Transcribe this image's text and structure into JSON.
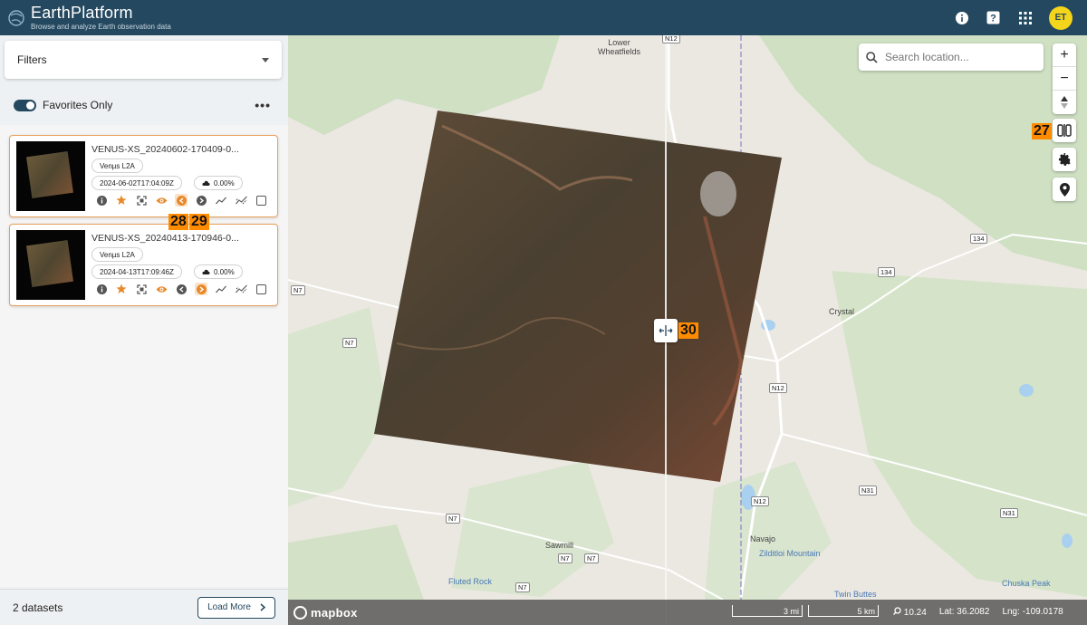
{
  "app": {
    "title": "EarthPlatform",
    "subtitle": "Browse and analyze Earth observation data",
    "user_initials": "ET"
  },
  "colors": {
    "header": "#24485f",
    "accent": "#e8a15d",
    "avatar": "#f4d51b"
  },
  "sidebar": {
    "filters_label": "Filters",
    "favorites_label": "Favorites Only",
    "favorites_enabled": true,
    "datasets": [
      {
        "title": "VENUS-XS_20240602-170409-0...",
        "product": "Venµs L2A",
        "datetime": "2024-06-02T17:04:09Z",
        "cloud": "0.00%"
      },
      {
        "title": "VENUS-XS_20240413-170946-0...",
        "product": "Venµs L2A",
        "datetime": "2024-04-13T17:09:46Z",
        "cloud": "0.00%"
      }
    ],
    "count_label": "2 datasets",
    "load_more_label": "Load More"
  },
  "annotations": {
    "t27": "27",
    "t28": "28",
    "t29": "29",
    "t30": "30"
  },
  "map": {
    "search_placeholder": "Search location...",
    "zoom_in": "+",
    "zoom_out": "−",
    "places": {
      "lower_wheatfields": "Lower\nWheatfields",
      "crystal": "Crystal",
      "sawmill": "Sawmill",
      "navajo": "Navajo",
      "zilditloi": "Zilditloi Mountain",
      "fluted_rock": "Fluted Rock",
      "twin_buttes": "Twin Buttes",
      "chuska_peak": "Chuska Peak"
    },
    "roads": {
      "n12": "N12",
      "n7": "N7",
      "n31": "N31",
      "n134": "134"
    },
    "attribution": "mapbox",
    "scale_mi": "3 mi",
    "scale_km": "5 km",
    "zoom_level": "10.24",
    "lat_label": "Lat:",
    "lat": "36.2082",
    "lng_label": "Lng:",
    "lng": "-109.0178"
  }
}
